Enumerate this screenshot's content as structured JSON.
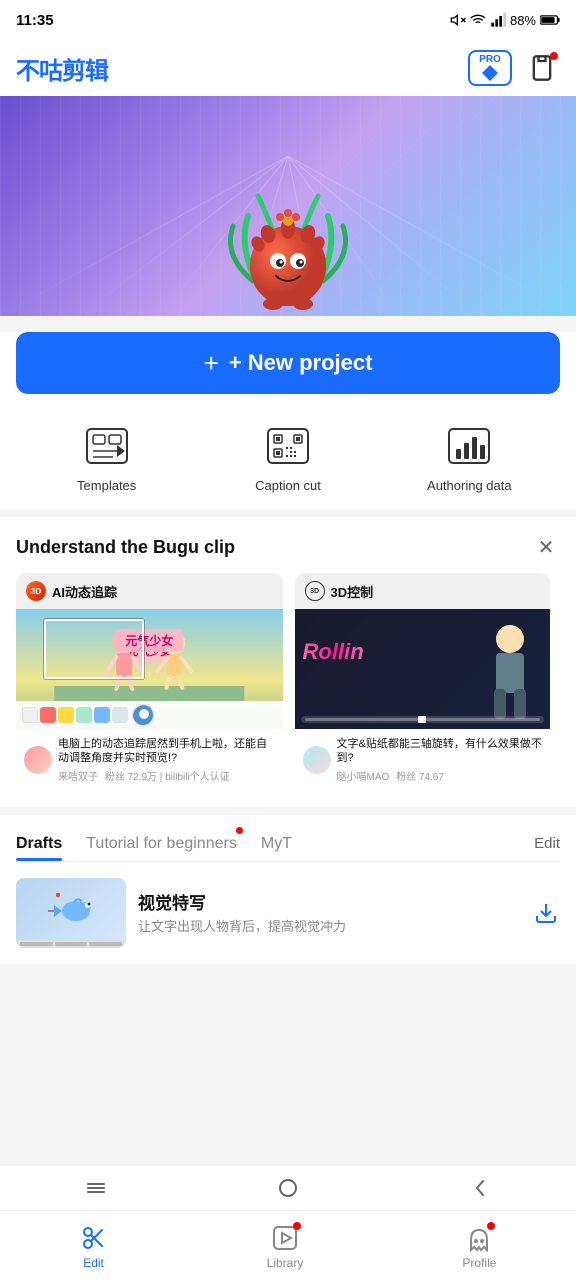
{
  "statusBar": {
    "time": "11:35",
    "battery": "88%"
  },
  "header": {
    "appName": "不咕剪辑",
    "proLabel": "PRO"
  },
  "hero": {
    "newProjectLabel": "+ New project"
  },
  "quickActions": [
    {
      "id": "templates",
      "label": "Templates"
    },
    {
      "id": "captionCut",
      "label": "Caption cut"
    },
    {
      "id": "authoringData",
      "label": "Authoring data"
    }
  ],
  "understandSection": {
    "title": "Understand the Bugu clip",
    "cards": [
      {
        "tagIcon": "🔴",
        "tagText": "AI动态追踪",
        "desc": "电脑上的动态追踪居然到手机上啦，还能自动调整角度并实时预览!?",
        "authorName": "来咭双子",
        "fans": "粉丝  72.9万",
        "platform": "bilibili个人认证"
      },
      {
        "tagIcon": "⭕",
        "tagText": "3D控制",
        "desc": "文字&贴纸都能三轴旋转，有什么效果做不到?",
        "authorName": "哒小喵MAO",
        "fans": "粉丝  74.67",
        "platform": ""
      }
    ]
  },
  "tabs": {
    "items": [
      {
        "id": "drafts",
        "label": "Drafts",
        "active": true,
        "hasDot": false
      },
      {
        "id": "tutorial",
        "label": "Tutorial for beginners",
        "active": false,
        "hasDot": true
      },
      {
        "id": "myt",
        "label": "MyT",
        "active": false,
        "hasDot": false
      }
    ],
    "editLabel": "Edit"
  },
  "drafts": [
    {
      "title": "视觉特写",
      "subtitle": "让文字出现人物背后，提高视觉冲力"
    }
  ],
  "bottomNav": {
    "items": [
      {
        "id": "edit",
        "label": "Edit",
        "active": true,
        "hasDot": false
      },
      {
        "id": "library",
        "label": "Library",
        "active": false,
        "hasDot": true
      },
      {
        "id": "profile",
        "label": "Profile",
        "active": false,
        "hasDot": true
      }
    ]
  },
  "palette": [
    "#f0f0f0",
    "#ff6b6b",
    "#ffd93d",
    "#a8e6cf",
    "#74b9ff",
    "#dfe6e9"
  ],
  "colors": {
    "primary": "#1a6bff",
    "accent": "#ff4444"
  }
}
